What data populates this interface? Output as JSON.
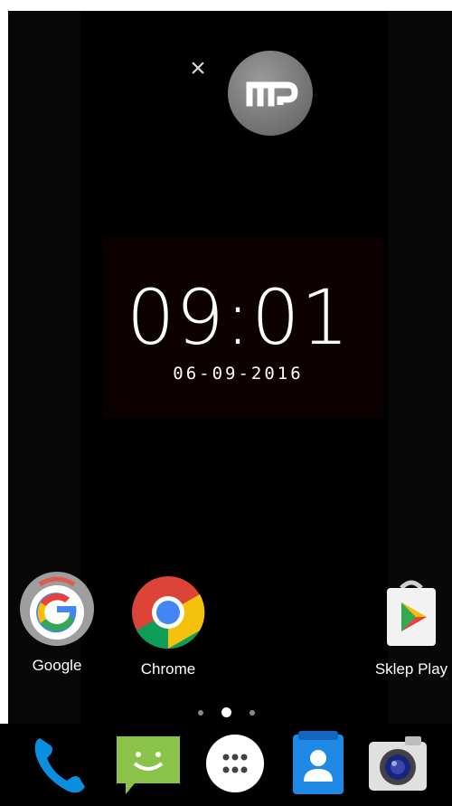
{
  "notification": {
    "close_glyph": "×",
    "icon": "mp-logo-icon"
  },
  "clock": {
    "time": "09:01",
    "date": "06-09-2016"
  },
  "apps": [
    {
      "label": "Google",
      "icon": "google-icon"
    },
    {
      "label": "Chrome",
      "icon": "chrome-icon"
    },
    {
      "label": "Sklep Play",
      "icon": "play-store-icon"
    }
  ],
  "page_indicator": {
    "count": 3,
    "active": 1
  },
  "dock": [
    {
      "icon": "phone-icon"
    },
    {
      "icon": "messaging-icon"
    },
    {
      "icon": "app-drawer-icon"
    },
    {
      "icon": "contacts-icon"
    },
    {
      "icon": "camera-icon"
    }
  ],
  "colors": {
    "phone_blue": "#0a8ee0",
    "messaging_green": "#8bc34a",
    "contacts_blue": "#1e88e5",
    "chrome_red": "#db4437",
    "chrome_yellow": "#f4c20d",
    "chrome_green": "#0f9d58",
    "chrome_blue": "#4285f4"
  }
}
